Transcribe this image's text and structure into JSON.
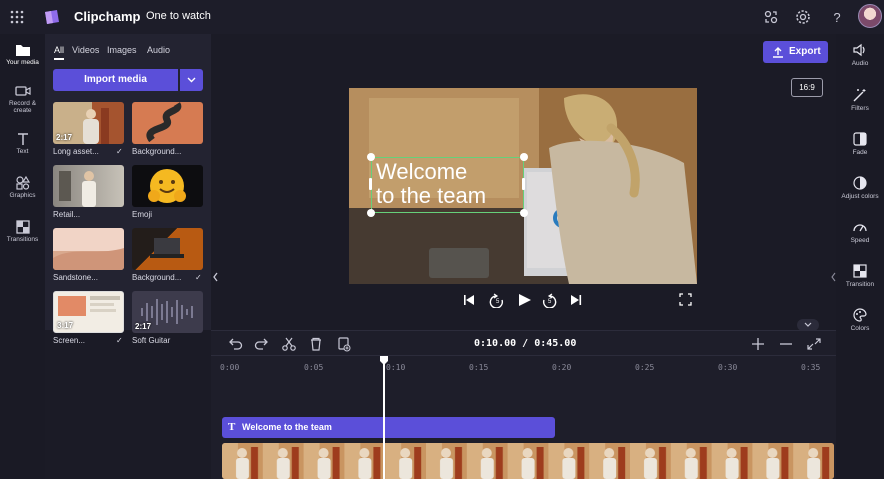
{
  "app": {
    "title": "Clipchamp",
    "project_title": "One to watch"
  },
  "left_rail": [
    {
      "label": "Your media",
      "icon": "folder-icon"
    },
    {
      "label": "Record & create",
      "icon": "camera-icon"
    },
    {
      "label": "Text",
      "icon": "text-icon"
    },
    {
      "label": "Graphics",
      "icon": "shapes-icon"
    },
    {
      "label": "Transitions",
      "icon": "transitions-icon"
    }
  ],
  "media_tabs": [
    "All",
    "Videos",
    "Images",
    "Audio"
  ],
  "import_button": "Import media",
  "media_items": [
    {
      "label": "Long asset...",
      "duration": "2:17",
      "checked": true
    },
    {
      "label": "Background...",
      "duration": "",
      "checked": false
    },
    {
      "label": "Retail...",
      "duration": "",
      "checked": false
    },
    {
      "label": "Emoji",
      "duration": "",
      "checked": false
    },
    {
      "label": "Sandstone...",
      "duration": "",
      "checked": false
    },
    {
      "label": "Background...",
      "duration": "",
      "checked": true
    },
    {
      "label": "Screen...",
      "duration": "3:17",
      "checked": true
    },
    {
      "label": "Soft Guitar",
      "duration": "2:17",
      "checked": false
    }
  ],
  "export_button": "Export",
  "aspect_ratio": "16:9",
  "preview_text": {
    "line1": "Welcome",
    "line2": "to the team"
  },
  "right_rail": [
    {
      "label": "Audio",
      "icon": "speaker-icon"
    },
    {
      "label": "Filters",
      "icon": "magic-wand-icon"
    },
    {
      "label": "Fade",
      "icon": "fade-icon"
    },
    {
      "label": "Adjust colors",
      "icon": "contrast-icon"
    },
    {
      "label": "Speed",
      "icon": "speedometer-icon"
    },
    {
      "label": "Transition",
      "icon": "transition-icon"
    },
    {
      "label": "Colors",
      "icon": "palette-icon"
    }
  ],
  "timeline": {
    "time_readout": "0:10.00 / 0:45.00",
    "ticks": [
      "0:00",
      "0:05",
      "0:10",
      "0:15",
      "0:20",
      "0:25",
      "0:30",
      "0:35"
    ],
    "text_clip_label": "Welcome to the team"
  },
  "colors": {
    "accent": "#5b4fd9",
    "background": "#1b1b26",
    "panel": "#232331"
  }
}
